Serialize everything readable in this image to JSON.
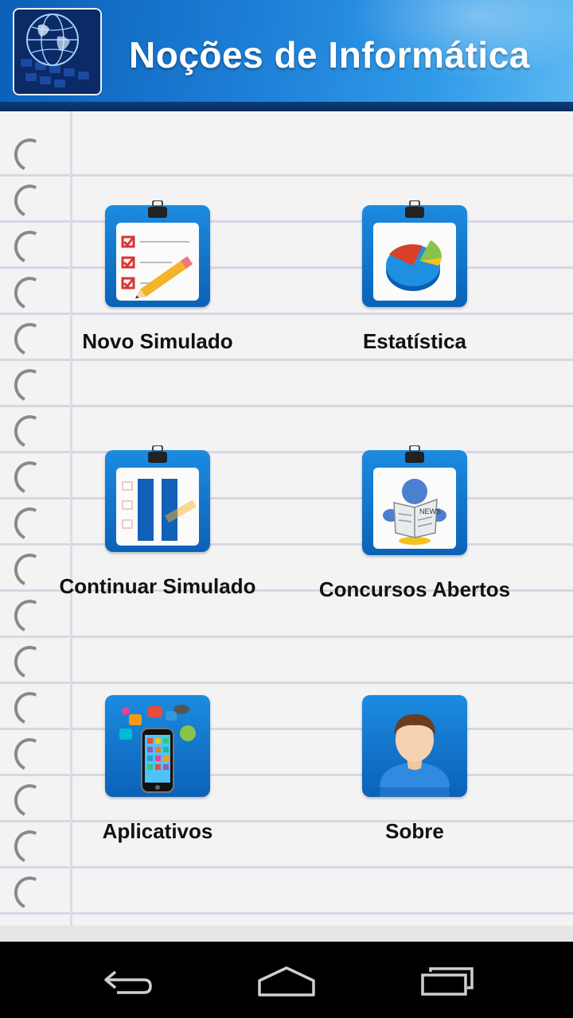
{
  "app": {
    "title": "Noções de Informática"
  },
  "menu": [
    {
      "label": "Novo Simulado",
      "icon": "checklist-clipboard-icon"
    },
    {
      "label": "Estatística",
      "icon": "pie-chart-clipboard-icon"
    },
    {
      "label": "Continuar Simulado",
      "icon": "pause-clipboard-icon"
    },
    {
      "label": "Concursos Abertos",
      "icon": "newspaper-reader-icon"
    },
    {
      "label": "Aplicativos",
      "icon": "smartphone-apps-icon"
    },
    {
      "label": "Sobre",
      "icon": "user-avatar-icon"
    }
  ],
  "navbar": {
    "back": "back-icon",
    "home": "home-icon",
    "recents": "recents-icon"
  },
  "colors": {
    "header": "#1e7fd6",
    "tile": "#0a62b8",
    "paper": "#f3f3f3"
  }
}
